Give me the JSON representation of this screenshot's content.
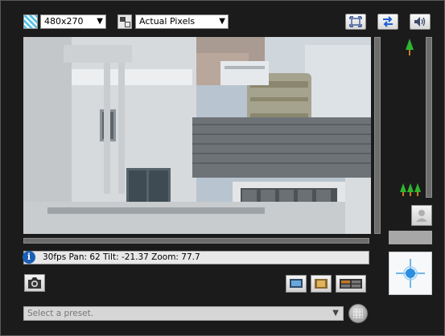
{
  "toolbar": {
    "capture_size": "480x270",
    "display_size": "Actual Pixels",
    "icons": [
      "capture-size-icon",
      "display-size-icon",
      "fullscreen-icon",
      "swap-icon",
      "speaker-icon"
    ]
  },
  "status": {
    "text": "30fps Pan: 62 Tilt: -21.37 Zoom: 77.7"
  },
  "zoom": {
    "tele_icon": "single-tree-icon",
    "wide_icon": "three-trees-icon"
  },
  "preset": {
    "placeholder": "Select a preset."
  },
  "colors": {
    "background": "#1b1b1b",
    "info_icon": "#1b5fb4",
    "tree_green": "#2fb52f",
    "pad_blue": "#2b8ee0"
  }
}
